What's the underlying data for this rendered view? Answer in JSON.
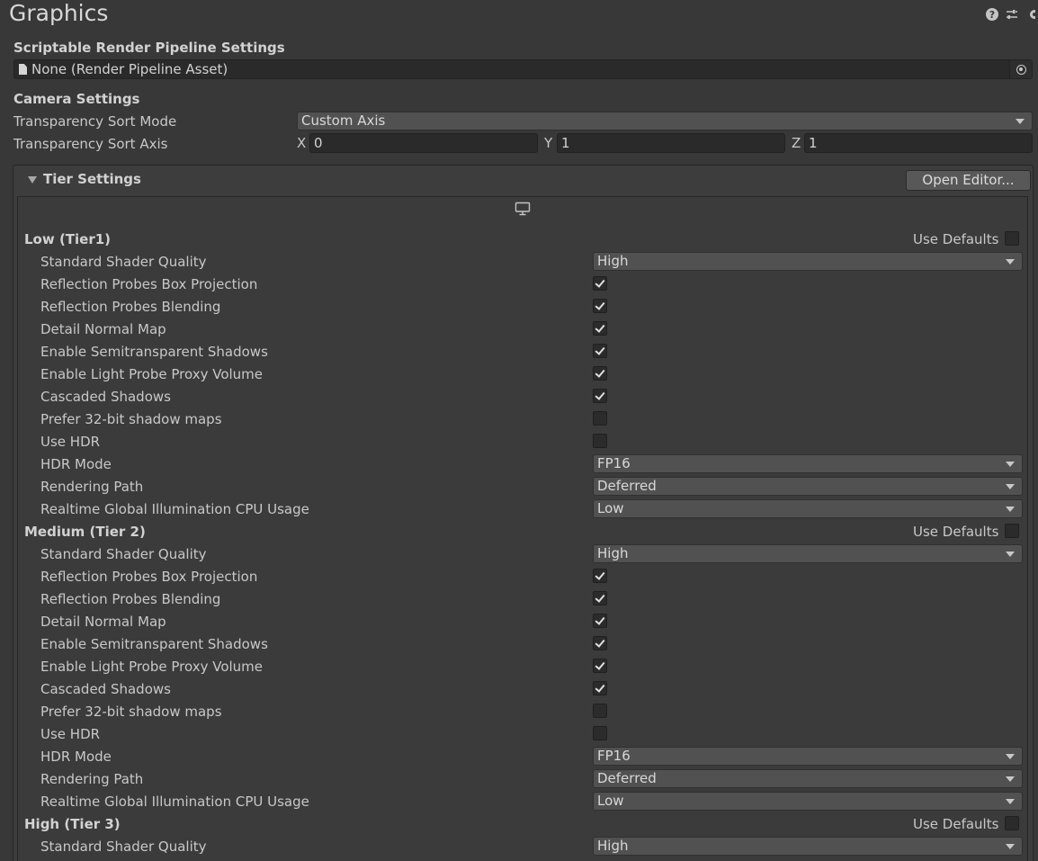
{
  "header": {
    "title": "Graphics",
    "help_icon": "help-icon",
    "preset_icon": "presets-icon",
    "menu_icon": "gear-icon"
  },
  "srp": {
    "label": "Scriptable Render Pipeline Settings",
    "value": "None (Render Pipeline Asset)"
  },
  "camera": {
    "label": "Camera Settings",
    "sort_mode_label": "Transparency Sort Mode",
    "sort_mode_value": "Custom Axis",
    "sort_axis_label": "Transparency Sort Axis",
    "x_label": "X",
    "x_value": "0",
    "y_label": "Y",
    "y_value": "1",
    "z_label": "Z",
    "z_value": "1"
  },
  "tier_settings": {
    "label": "Tier Settings",
    "open_editor": "Open Editor...",
    "use_defaults_label": "Use Defaults",
    "tiers": [
      {
        "title": "Low (Tier1)",
        "use_defaults": false,
        "standard_shader_quality": {
          "label": "Standard Shader Quality",
          "value": "High"
        },
        "checks": [
          {
            "label": "Reflection Probes Box Projection",
            "checked": true
          },
          {
            "label": "Reflection Probes Blending",
            "checked": true
          },
          {
            "label": "Detail Normal Map",
            "checked": true
          },
          {
            "label": "Enable Semitransparent Shadows",
            "checked": true
          },
          {
            "label": "Enable Light Probe Proxy Volume",
            "checked": true
          },
          {
            "label": "Cascaded Shadows",
            "checked": true
          },
          {
            "label": "Prefer 32-bit shadow maps",
            "checked": false
          },
          {
            "label": "Use HDR",
            "checked": false
          }
        ],
        "hdr_mode": {
          "label": "HDR Mode",
          "value": "FP16"
        },
        "rendering_path": {
          "label": "Rendering Path",
          "value": "Deferred"
        },
        "gi_cpu": {
          "label": "Realtime Global Illumination CPU Usage",
          "value": "Low"
        }
      },
      {
        "title": "Medium (Tier 2)",
        "use_defaults": false,
        "standard_shader_quality": {
          "label": "Standard Shader Quality",
          "value": "High"
        },
        "checks": [
          {
            "label": "Reflection Probes Box Projection",
            "checked": true
          },
          {
            "label": "Reflection Probes Blending",
            "checked": true
          },
          {
            "label": "Detail Normal Map",
            "checked": true
          },
          {
            "label": "Enable Semitransparent Shadows",
            "checked": true
          },
          {
            "label": "Enable Light Probe Proxy Volume",
            "checked": true
          },
          {
            "label": "Cascaded Shadows",
            "checked": true
          },
          {
            "label": "Prefer 32-bit shadow maps",
            "checked": false
          },
          {
            "label": "Use HDR",
            "checked": false
          }
        ],
        "hdr_mode": {
          "label": "HDR Mode",
          "value": "FP16"
        },
        "rendering_path": {
          "label": "Rendering Path",
          "value": "Deferred"
        },
        "gi_cpu": {
          "label": "Realtime Global Illumination CPU Usage",
          "value": "Low"
        }
      },
      {
        "title": "High (Tier 3)",
        "use_defaults": false,
        "standard_shader_quality": {
          "label": "Standard Shader Quality",
          "value": "High"
        }
      }
    ]
  }
}
